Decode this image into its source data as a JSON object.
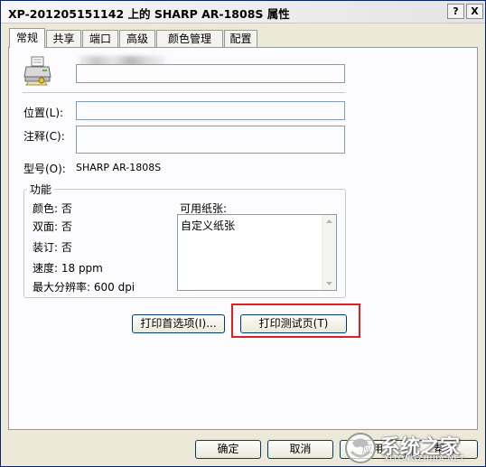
{
  "window": {
    "title": "XP-201205151142 上的 SHARP AR-1808S 属性",
    "help_button": "?",
    "close_button": "X"
  },
  "tabs": [
    "常规",
    "共享",
    "端口",
    "高级",
    "颜色管理",
    "配置"
  ],
  "general": {
    "location_label": "位置(L):",
    "comment_label": "注释(C):",
    "model_label": "型号(O):",
    "model_value": "SHARP AR-1808S"
  },
  "features": {
    "title": "功能",
    "color": "颜色: 否",
    "duplex": "双面: 否",
    "staple": "装订: 否",
    "speed": "速度: 18 ppm",
    "max_resolution": "最大分辨率: 600 dpi",
    "paper_label": "可用纸张:",
    "paper_items": [
      "自定义纸张"
    ]
  },
  "buttons": {
    "preferences": "打印首选项(I)...",
    "test_page": "打印测试页(T)",
    "ok": "确定",
    "cancel": "取消",
    "apply": "应用",
    "help": "帮助"
  },
  "watermark": {
    "text": "系统之家",
    "subtext": "XITONGZHIJIA.NET"
  },
  "colors": {
    "highlight_box": "#e02020",
    "window_bg": "#ece9d8",
    "panel_bg": "#fcfcfe"
  }
}
